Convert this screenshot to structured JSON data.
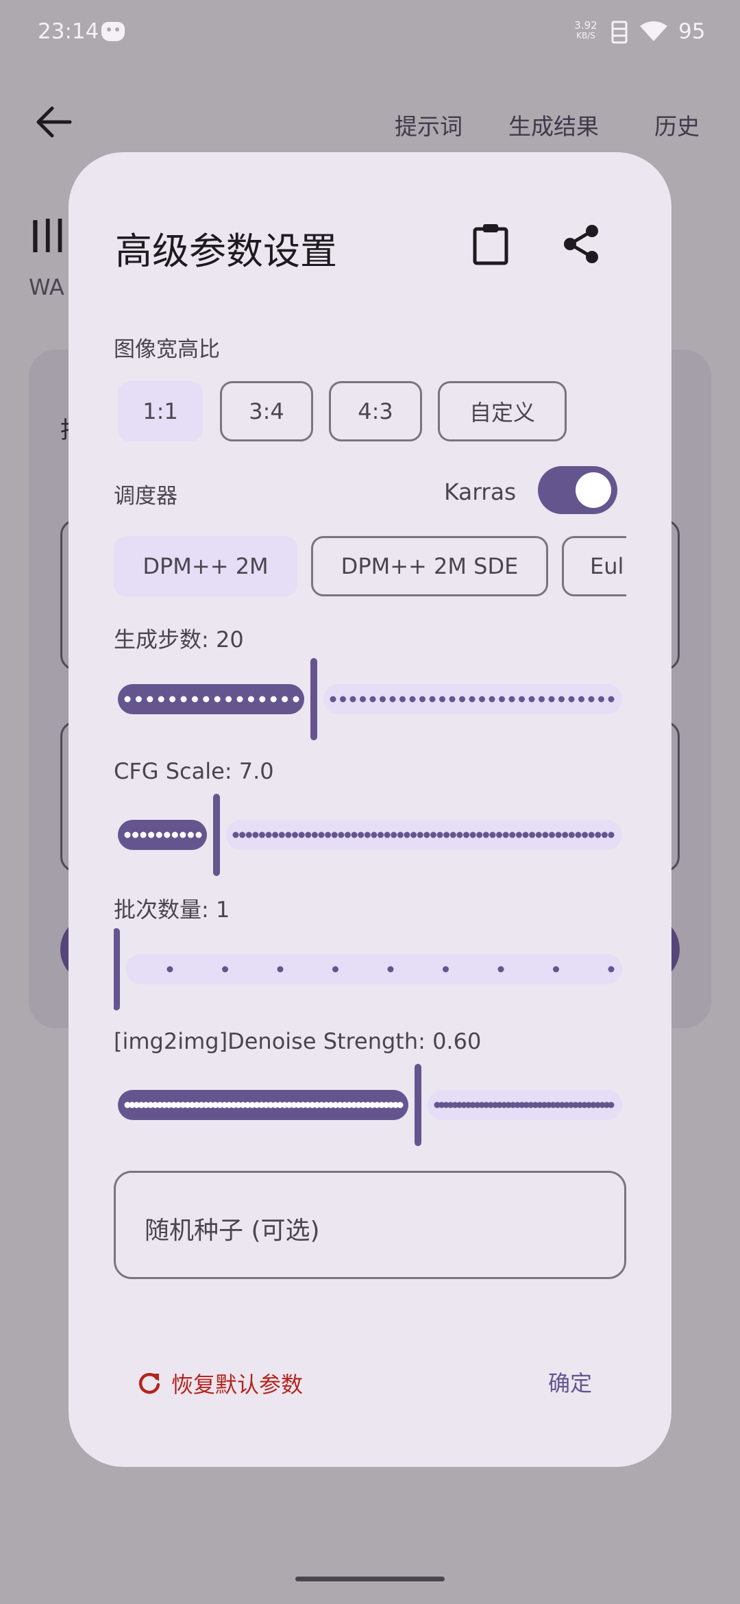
{
  "status_bar": {
    "time": "23:14",
    "net_speed_value": "3.92",
    "net_speed_unit": "KB/S",
    "battery": "95"
  },
  "top_tabs": [
    "提示词",
    "生成结果",
    "历史"
  ],
  "background": {
    "title_partial": "Illu",
    "subtitle_partial": "WA",
    "card_letter": "批"
  },
  "dialog": {
    "title": "高级参数设置",
    "aspect_ratio": {
      "label": "图像宽高比",
      "options": [
        "1:1",
        "3:4",
        "4:3",
        "自定义"
      ],
      "selected": "1:1"
    },
    "scheduler": {
      "label": "调度器",
      "karras_label": "Karras",
      "karras_on": true,
      "options": [
        "DPM++ 2M",
        "DPM++ 2M SDE",
        "Eul"
      ],
      "selected": "DPM++ 2M"
    },
    "steps": {
      "label": "生成步数: 20",
      "value": 20,
      "min": 1,
      "max": 50
    },
    "cfg": {
      "label": "CFG Scale: 7.0",
      "value": 7.0,
      "min": 1,
      "max": 30
    },
    "batch": {
      "label": "批次数量: 1",
      "value": 1,
      "min": 1,
      "max": 10
    },
    "denoise": {
      "label": "[img2img]Denoise Strength: 0.60",
      "value": 0.6,
      "min": 0,
      "max": 1
    },
    "seed_placeholder": "随机种子 (可选)",
    "reset_label": "恢复默认参数",
    "confirm_label": "确定"
  },
  "colors": {
    "primary": "#65558f",
    "secondary_container": "#e6ddf7",
    "surface": "#ece6f0",
    "error": "#b3261e"
  },
  "icons": [
    "back-arrow-icon",
    "clipboard-icon",
    "share-icon",
    "refresh-icon",
    "wifi-icon",
    "sim-icon"
  ]
}
